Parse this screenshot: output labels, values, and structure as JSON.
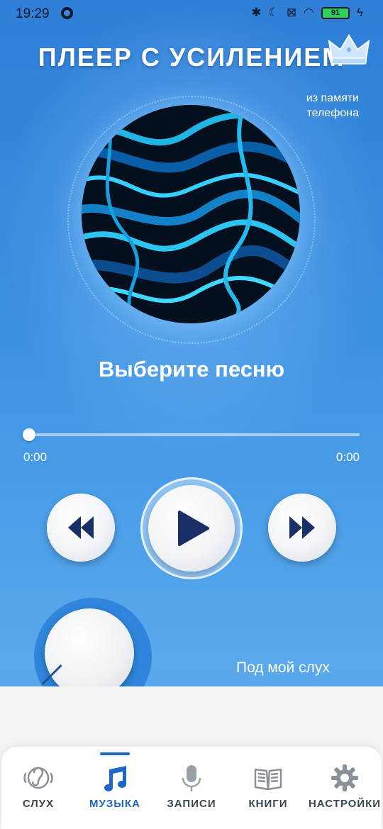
{
  "status_bar": {
    "time": "19:29",
    "battery": "91"
  },
  "header": {
    "title": "ПЛЕЕР С УСИЛЕНИЕМ",
    "source_label": "из памяти телефона"
  },
  "player": {
    "song_title": "Выберите песню",
    "time_elapsed": "0:00",
    "time_total": "0:00",
    "progress": 0
  },
  "hearing": {
    "label": "Под мой слух"
  },
  "nav": {
    "items": [
      {
        "label": "СЛУХ",
        "icon": "ear-icon"
      },
      {
        "label": "МУЗЫКА",
        "icon": "music-note-icon",
        "active": true
      },
      {
        "label": "ЗАПИСИ",
        "icon": "microphone-icon"
      },
      {
        "label": "КНИГИ",
        "icon": "book-icon"
      },
      {
        "label": "НАСТРОЙКИ",
        "icon": "gear-icon"
      }
    ]
  },
  "colors": {
    "accent": "#1f66c9",
    "background": "#3a8ee0",
    "button_icon": "#1a2f66"
  }
}
